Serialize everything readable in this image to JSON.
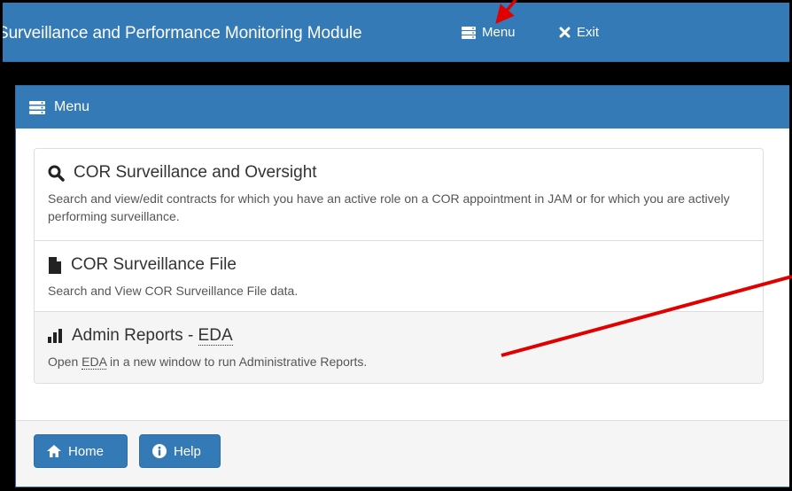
{
  "navbar": {
    "title": "Surveillance and Performance Monitoring Module",
    "menu_label": "Menu",
    "exit_label": "Exit"
  },
  "panel": {
    "heading": "Menu"
  },
  "menu_items": [
    {
      "title": "COR Surveillance and Oversight",
      "description": "Search and view/edit contracts for which you have an active role on a COR appointment in JAM or for which you are actively performing surveillance.",
      "icon": "search-icon"
    },
    {
      "title": "COR Surveillance File",
      "description": "Search and View COR Surveillance File data.",
      "icon": "file-icon"
    },
    {
      "title_prefix": "Admin Reports - ",
      "title_abbr": "EDA",
      "desc_prefix": "Open ",
      "desc_abbr": "EDA",
      "desc_suffix": " in a new window to run Administrative Reports.",
      "icon": "bar-chart-icon"
    }
  ],
  "footer": {
    "home_label": "Home",
    "help_label": "Help"
  },
  "colors": {
    "primary": "#337ab7",
    "annotation": "#e00000"
  }
}
